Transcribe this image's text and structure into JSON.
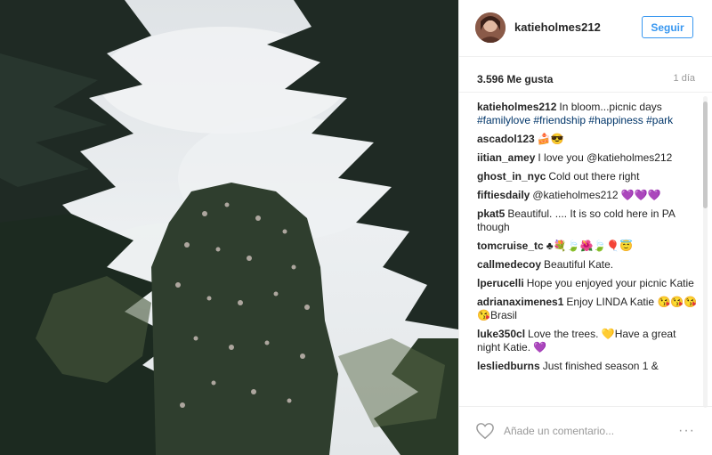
{
  "post": {
    "username": "katieholmes212",
    "follow_label": "Seguir",
    "likes": "3.596 Me gusta",
    "time": "1 día",
    "caption": {
      "user": "katieholmes212",
      "text": "In bloom...picnic days",
      "tags": "#familylove #friendship #happiness #park"
    }
  },
  "comments": [
    {
      "user": "ascadol123",
      "text": "🍰😎"
    },
    {
      "user": "iitian_amey",
      "text": "I love you @katieholmes212"
    },
    {
      "user": "ghost_in_nyc",
      "text": "Cold out there right"
    },
    {
      "user": "fiftiesdaily",
      "text": "@katieholmes212 💜💜💜"
    },
    {
      "user": "pkat5",
      "text": "Beautiful. .... It is so cold here in PA though"
    },
    {
      "user": "tomcruise_tc",
      "text": "♣💐🍃🌺🍃🎈😇"
    },
    {
      "user": "callmedecoy",
      "text": "Beautiful Kate."
    },
    {
      "user": "lperucelli",
      "text": "Hope you enjoyed your picnic Katie"
    },
    {
      "user": "adrianaximenes1",
      "text": "Enjoy LINDA Katie 😘😘😘😘Brasil"
    },
    {
      "user": "luke350cl",
      "text": "Love the trees. 💛Have a great night Katie. 💜"
    },
    {
      "user": "lesliedburns",
      "text": "Just finished season 1 &"
    }
  ],
  "footer": {
    "comment_placeholder": "Añade un comentario...",
    "more_label": "···"
  },
  "icons": {
    "like": "heart-icon",
    "options": "more-options-icon"
  },
  "colors": {
    "accent": "#3897f0",
    "hashtag": "#003569",
    "muted": "#999999"
  }
}
